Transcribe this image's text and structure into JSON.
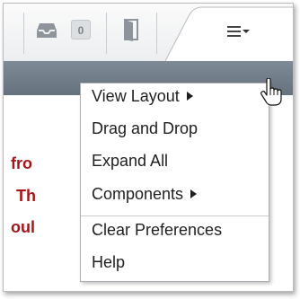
{
  "toolbar": {
    "count": "0",
    "icons": [
      "inbox-icon",
      "door-icon",
      "hamburger-icon",
      "caret-down-icon"
    ]
  },
  "content": {
    "fragments": [
      "fro",
      "Th",
      "oul"
    ]
  },
  "menu": {
    "items": [
      {
        "label": "View Layout",
        "submenu": true
      },
      {
        "label": "Drag and Drop",
        "submenu": false
      },
      {
        "label": "Expand All",
        "submenu": false
      },
      {
        "label": "Components",
        "submenu": true
      },
      {
        "label": "Clear Preferences",
        "submenu": false
      },
      {
        "label": "Help",
        "submenu": false
      }
    ]
  },
  "colors": {
    "banner": "#6f7b88",
    "content_text": "#a3161a",
    "menu_border": "#aab0b6"
  }
}
